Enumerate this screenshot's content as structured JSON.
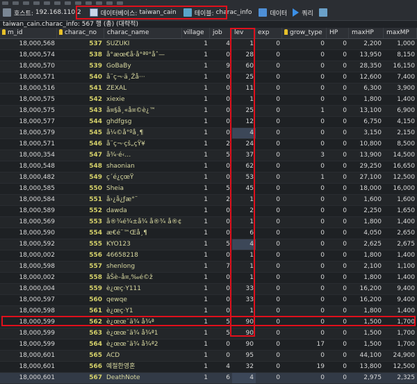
{
  "tabs": {
    "host_label": "호스트:",
    "host_value": "192.168.110.2",
    "db_label": "데이터베이스:",
    "db_value": "taiwan_cain",
    "table_label": "테이블:",
    "table_value": "charac_info",
    "data_tab": "데이터",
    "query_tab": "쿼리"
  },
  "status": "taiwan_cain.charac_info: 567 행 (총) (대략적)",
  "columns": [
    "m_id",
    "charac_no",
    "charac_name",
    "village",
    "job",
    "lev",
    "exp",
    "grow_type",
    "HP",
    "maxHP",
    "maxMP"
  ],
  "rows": [
    [
      "18,000,568",
      "537",
      "SUZUKI",
      "1",
      "4",
      "1",
      "0",
      "0",
      "0",
      "2,200",
      "1,000"
    ],
    [
      "18,000,574",
      "538",
      "å°æœ€å·å°ªº°åˆ—",
      "1",
      "0",
      "28",
      "0",
      "0",
      "0",
      "13,950",
      "8,150"
    ],
    [
      "18,000,570",
      "539",
      "GoBaBy",
      "1",
      "9",
      "60",
      "0",
      "0",
      "0",
      "28,350",
      "16,150"
    ],
    [
      "18,000,571",
      "540",
      "å¨ç¬·ä¸Žå···",
      "1",
      "0",
      "25",
      "0",
      "0",
      "0",
      "12,600",
      "7,400"
    ],
    [
      "18,000,516",
      "541",
      "ZEXAL",
      "1",
      "0",
      "11",
      "0",
      "0",
      "0",
      "6,300",
      "3,900"
    ],
    [
      "18,000,575",
      "542",
      "xiexie",
      "1",
      "0",
      "1",
      "0",
      "0",
      "0",
      "1,800",
      "1,400"
    ],
    [
      "18,000,575",
      "543",
      "å¤§å¸«å¤©è¿™",
      "1",
      "0",
      "25",
      "0",
      "1",
      "0",
      "13,100",
      "6,900"
    ],
    [
      "18,000,577",
      "544",
      "ghdfgsg",
      "1",
      "0",
      "12",
      "0",
      "0",
      "0",
      "6,750",
      "4,150"
    ],
    [
      "18,000,579",
      "545",
      "å¼©å°ºå¸¶",
      "1",
      "0",
      "4",
      "0",
      "0",
      "0",
      "3,150",
      "2,150"
    ],
    [
      "18,000,571",
      "546",
      "å¨ç¬·çš„çŸ¥",
      "1",
      "2",
      "24",
      "0",
      "0",
      "0",
      "10,800",
      "8,500"
    ],
    [
      "18,000,354",
      "547",
      "å¾·é‹…",
      "1",
      "5",
      "37",
      "0",
      "3",
      "0",
      "13,900",
      "14,500"
    ],
    [
      "18,000,548",
      "548",
      "shaonian",
      "1",
      "0",
      "62",
      "0",
      "0",
      "0",
      "29,250",
      "16,650"
    ],
    [
      "18,000,482",
      "549",
      "ç´é¿çœŸ",
      "1",
      "0",
      "53",
      "0",
      "1",
      "0",
      "27,100",
      "12,500"
    ],
    [
      "18,000,585",
      "550",
      "Sheia",
      "1",
      "5",
      "45",
      "0",
      "0",
      "0",
      "18,000",
      "16,000"
    ],
    [
      "18,000,584",
      "551",
      "å›¿å¿ƒæ°¨",
      "1",
      "2",
      "1",
      "0",
      "0",
      "0",
      "1,600",
      "1,600"
    ],
    [
      "18,000,589",
      "552",
      "dawda",
      "1",
      "0",
      "2",
      "0",
      "0",
      "0",
      "2,250",
      "1,650"
    ],
    [
      "18,000,569",
      "553",
      "å®¾é¾±å¾ å®¾ å®¢",
      "1",
      "0",
      "1",
      "0",
      "0",
      "0",
      "1,800",
      "1,400"
    ],
    [
      "18,000,590",
      "554",
      "æ€é¨™Œå¸¶",
      "1",
      "0",
      "6",
      "0",
      "0",
      "0",
      "4,050",
      "2,650"
    ],
    [
      "18,000,592",
      "555",
      "KYO123",
      "1",
      "5",
      "4",
      "0",
      "0",
      "0",
      "2,625",
      "2,675"
    ],
    [
      "18,000,002",
      "556",
      "46658218",
      "1",
      "0",
      "1",
      "0",
      "0",
      "0",
      "1,800",
      "1,400"
    ],
    [
      "18,000,598",
      "557",
      "shenlong",
      "1",
      "7",
      "1",
      "0",
      "0",
      "0",
      "2,100",
      "1,100"
    ],
    [
      "18,000,002",
      "558",
      "åŠè–å¤‚‰é©ž",
      "1",
      "0",
      "1",
      "0",
      "0",
      "0",
      "1,800",
      "1,400"
    ],
    [
      "18,000,004",
      "559",
      "è¿œç·Y111",
      "1",
      "0",
      "33",
      "0",
      "0",
      "0",
      "16,200",
      "9,400"
    ],
    [
      "18,000,597",
      "560",
      "qewqe",
      "1",
      "0",
      "33",
      "0",
      "0",
      "0",
      "16,200",
      "9,400"
    ],
    [
      "18,000,598",
      "561",
      "è¿œç·Y1",
      "1",
      "0",
      "1",
      "0",
      "0",
      "0",
      "1,800",
      "1,400"
    ],
    [
      "18,000,599",
      "562",
      "è¿œœ¯ã¾ å¾ª",
      "1",
      "5",
      "90",
      "0",
      "0",
      "0",
      "1,500",
      "1,700"
    ],
    [
      "18,000,599",
      "563",
      "è¿œœ¯ã¾ å¾ª1",
      "1",
      "5",
      "90",
      "0",
      "0",
      "0",
      "1,500",
      "1,700"
    ],
    [
      "18,000,599",
      "564",
      "è¿œœ¯ã¾ å¾ª2",
      "1",
      "0",
      "90",
      "0",
      "17",
      "0",
      "1,500",
      "1,700"
    ],
    [
      "18,000,601",
      "565",
      "ACD",
      "1",
      "0",
      "95",
      "0",
      "0",
      "0",
      "44,100",
      "24,900"
    ],
    [
      "18,000,601",
      "566",
      "예절한영혼",
      "1",
      "4",
      "32",
      "0",
      "19",
      "0",
      "13,800",
      "12,500"
    ],
    [
      "18,000,601",
      "567",
      "DeathNote",
      "1",
      "6",
      "4",
      "0",
      "0",
      "0",
      "2,975",
      "2,325"
    ]
  ]
}
